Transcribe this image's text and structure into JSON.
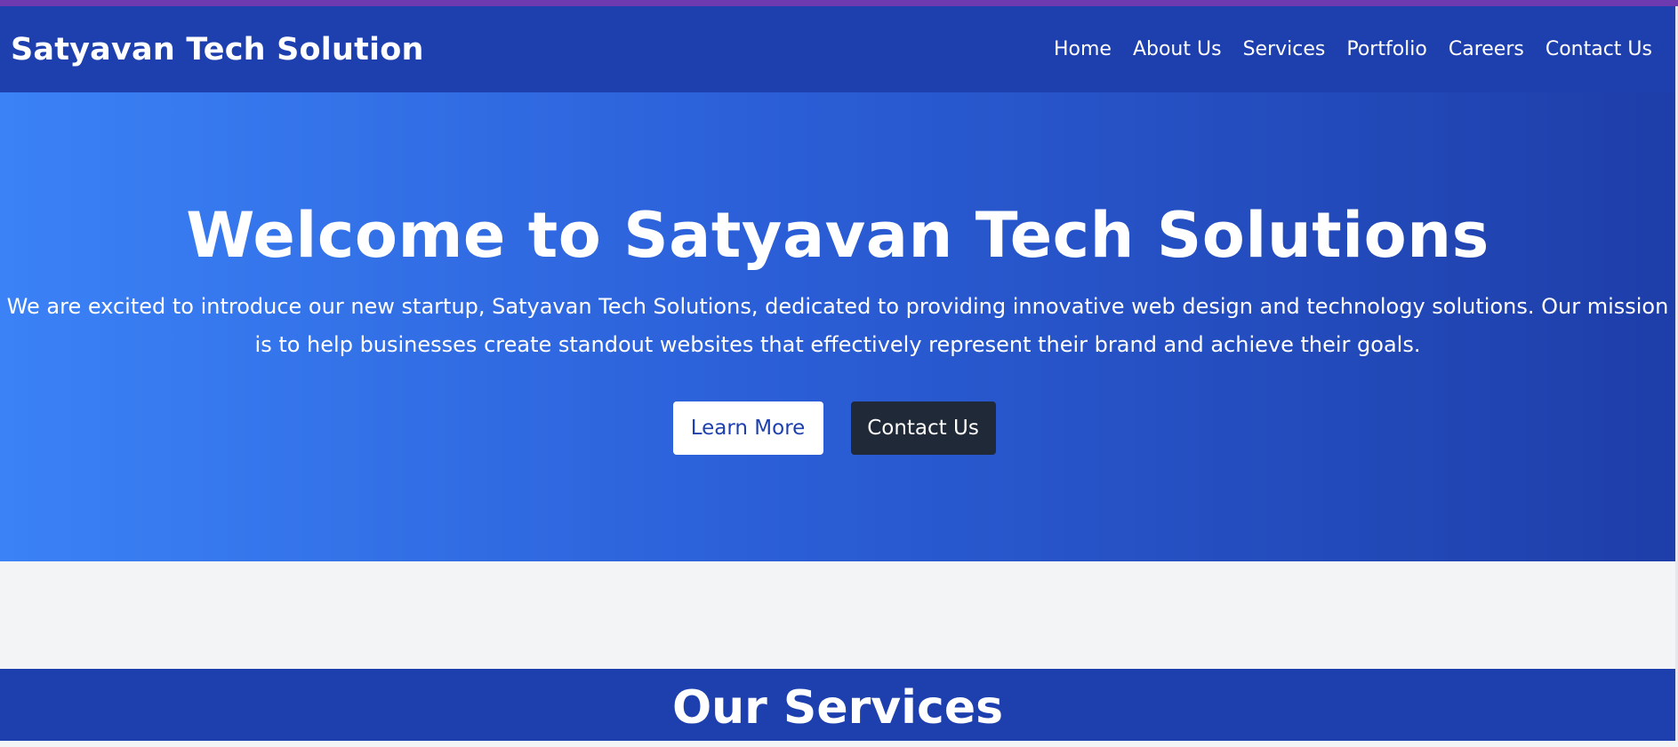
{
  "brand": "Satyavan Tech Solution",
  "nav": [
    "Home",
    "About Us",
    "Services",
    "Portfolio",
    "Careers",
    "Contact Us"
  ],
  "hero": {
    "title": "Welcome to Satyavan Tech Solutions",
    "text": "We are excited to introduce our new startup, Satyavan Tech Solutions, dedicated to providing innovative web design and technology solutions. Our mission is to help businesses create standout websites that effectively represent their brand and achieve their goals.",
    "learn_more": "Learn More",
    "contact": "Contact Us"
  },
  "services": {
    "title": "Our Services"
  },
  "colors": {
    "primary": "#1e40af",
    "hero_start": "#3b82f6",
    "dark_button": "#1f2937",
    "top_strip": "#6d3ab0"
  }
}
